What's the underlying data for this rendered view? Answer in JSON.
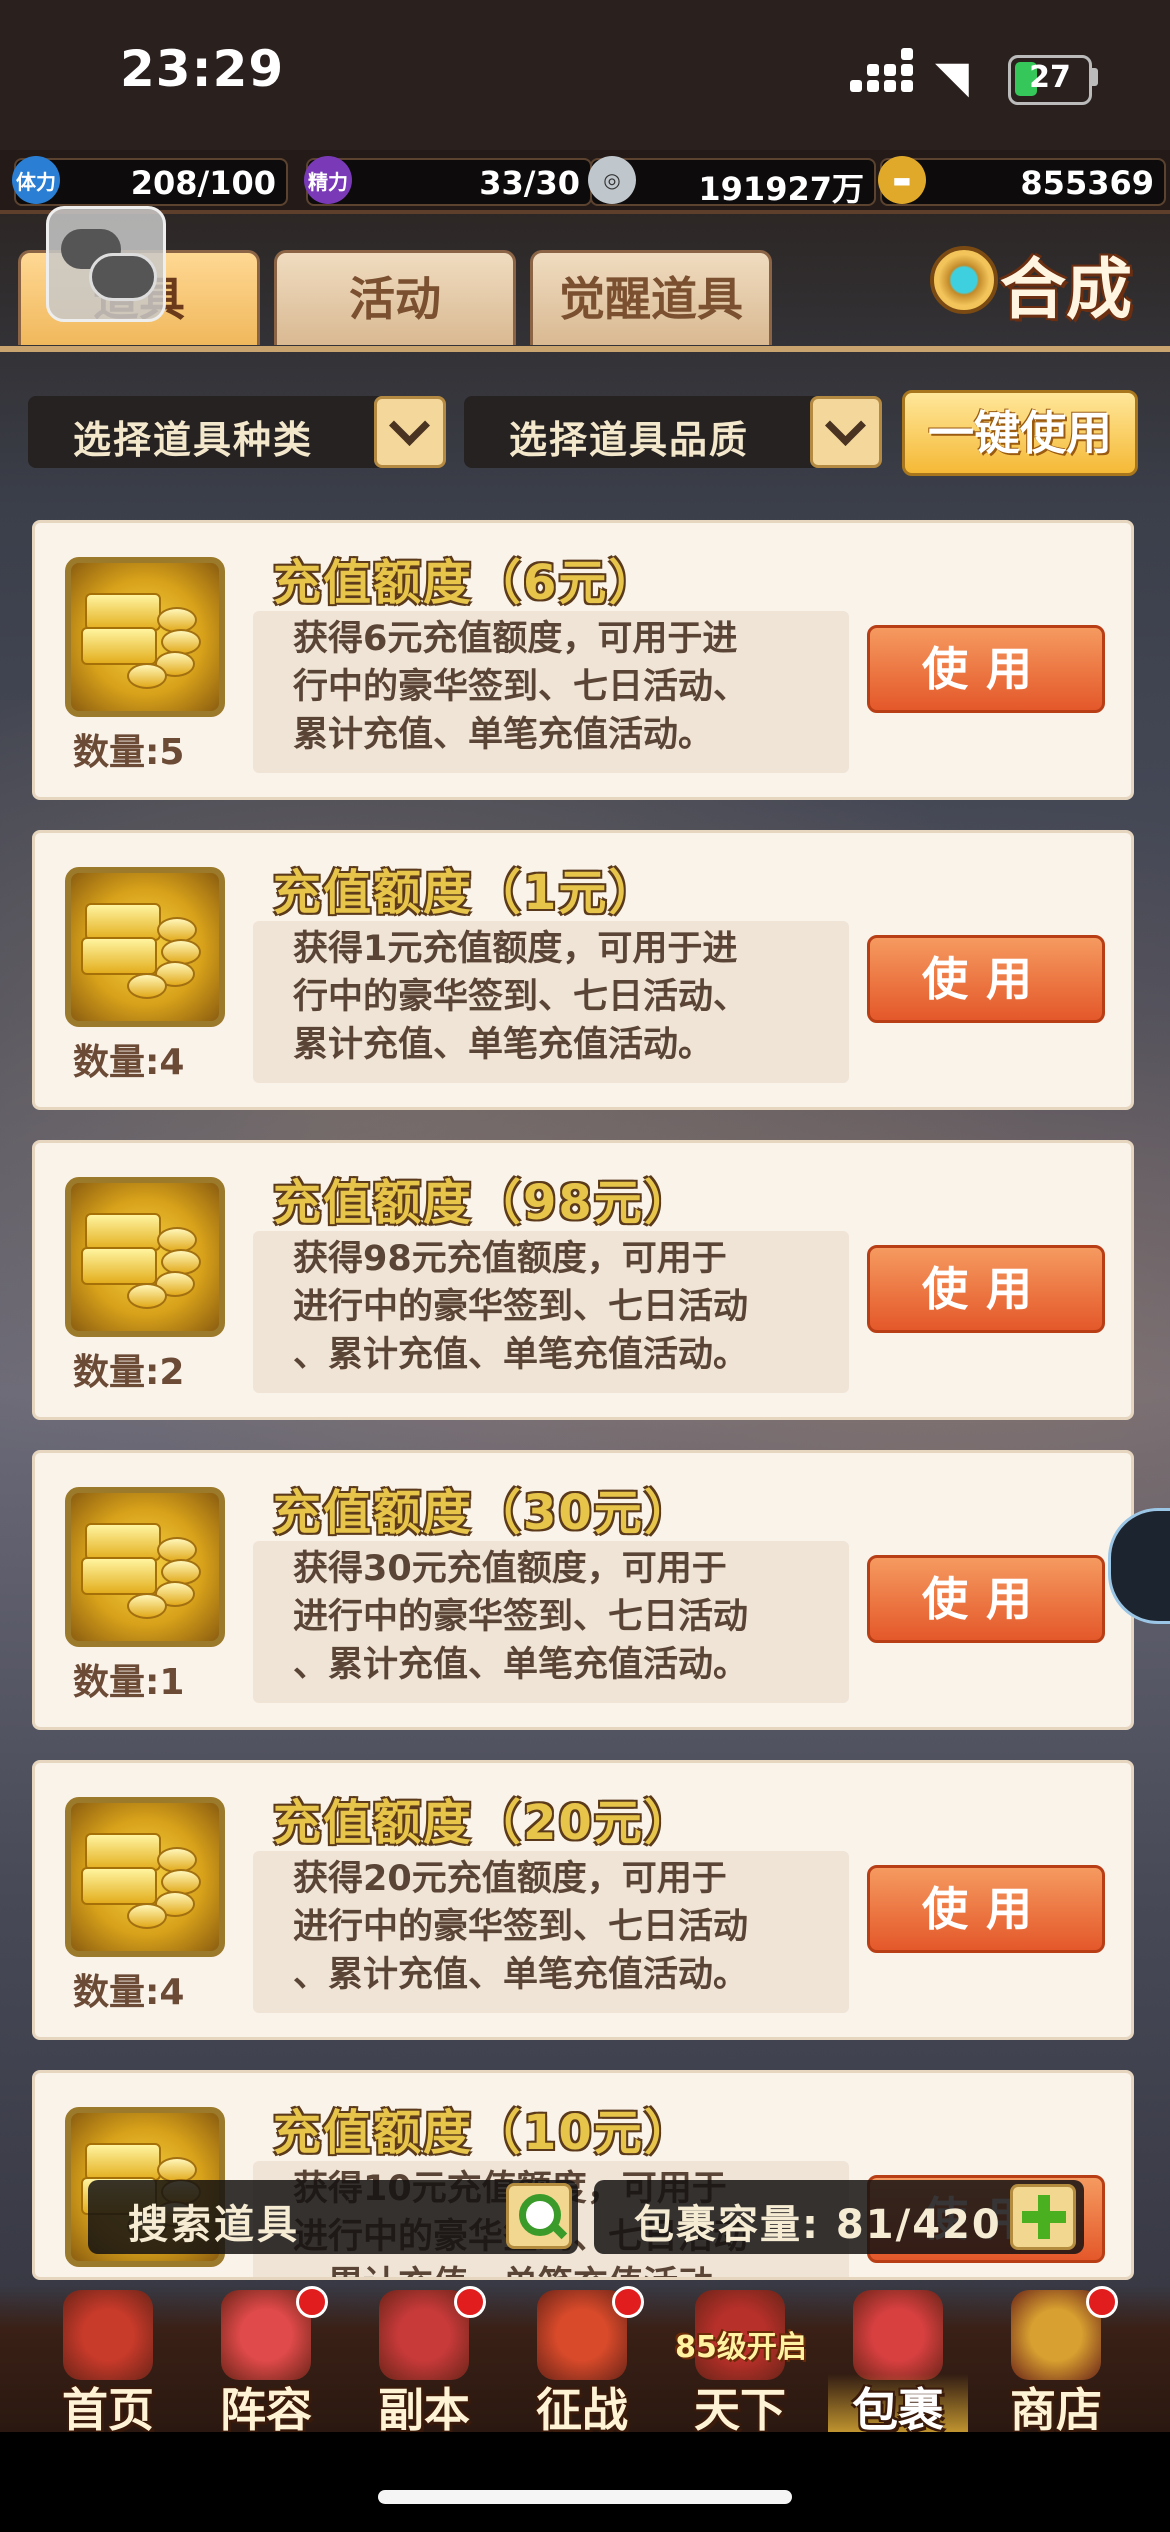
{
  "status": {
    "time": "23:29",
    "battery": "27"
  },
  "resources": [
    {
      "icon": "stamina-icon",
      "label": "体力",
      "value": "208/100",
      "color": "#2a7fd4"
    },
    {
      "icon": "energy-icon",
      "label": "精力",
      "value": "33/30",
      "color": "#7a3ab8"
    },
    {
      "icon": "coin-icon",
      "label": "",
      "value": "191927万",
      "color": "#bfc6cc"
    },
    {
      "icon": "gold-ingot-icon",
      "label": "",
      "value": "855369",
      "color": "#e0a92a"
    }
  ],
  "tabs": [
    {
      "label": "道具",
      "active": true
    },
    {
      "label": "活动",
      "active": false
    },
    {
      "label": "觉醒道具",
      "active": false
    }
  ],
  "synthesis_label": "合成",
  "filters": {
    "type_label": "选择道具种类",
    "quality_label": "选择道具品质",
    "one_key_use": "一键使用"
  },
  "items": [
    {
      "title": "充值额度（6元）",
      "desc": [
        "获得6元充值额度，可用于进",
        "行中的豪华签到、七日活动、",
        "累计充值、单笔充值活动。"
      ],
      "qty": "数量:5",
      "use": "使用"
    },
    {
      "title": "充值额度（1元）",
      "desc": [
        "获得1元充值额度，可用于进",
        "行中的豪华签到、七日活动、",
        "累计充值、单笔充值活动。"
      ],
      "qty": "数量:4",
      "use": "使用"
    },
    {
      "title": "充值额度（98元）",
      "desc": [
        "获得98元充值额度，可用于",
        "进行中的豪华签到、七日活动",
        "、累计充值、单笔充值活动。"
      ],
      "qty": "数量:2",
      "use": "使用"
    },
    {
      "title": "充值额度（30元）",
      "desc": [
        "获得30元充值额度，可用于",
        "进行中的豪华签到、七日活动",
        "、累计充值、单笔充值活动。"
      ],
      "qty": "数量:1",
      "use": "使用"
    },
    {
      "title": "充值额度（20元）",
      "desc": [
        "获得20元充值额度，可用于",
        "进行中的豪华签到、七日活动",
        "、累计充值、单笔充值活动。"
      ],
      "qty": "数量:4",
      "use": "使用"
    },
    {
      "title": "充值额度（10元）",
      "desc": [
        "获得10元充值额度，可用于",
        "进行中的豪华签到、七日活动",
        "、累计充值、单笔充值活动。"
      ],
      "qty": "",
      "use": "使用"
    }
  ],
  "search": {
    "label": "搜索道具"
  },
  "capacity": {
    "label": "包裹容量: 81/420"
  },
  "nav": [
    {
      "label": "首页",
      "icon": "palace-icon",
      "dot": false,
      "color": "#c83a2a"
    },
    {
      "label": "阵容",
      "icon": "flag-icon",
      "dot": true,
      "color": "#e04a4a"
    },
    {
      "label": "副本",
      "icon": "crossed-swords-icon",
      "dot": true,
      "color": "#c83a3a"
    },
    {
      "label": "征战",
      "icon": "target-icon",
      "dot": true,
      "color": "#d84a2a"
    },
    {
      "label": "天下",
      "icon": "war-drum-icon",
      "dot": false,
      "color": "#b8302a",
      "badge": "85级开启"
    },
    {
      "label": "包裹",
      "icon": "bag-icon",
      "dot": false,
      "color": "#d84040",
      "active": true
    },
    {
      "label": "商店",
      "icon": "coins-icon",
      "dot": true,
      "color": "#d8a030"
    }
  ]
}
